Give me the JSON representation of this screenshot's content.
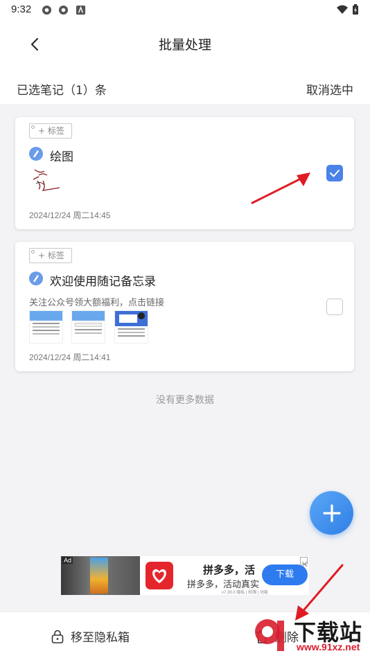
{
  "status_bar": {
    "time": "9:32"
  },
  "header": {
    "title": "批量处理",
    "selected_count": "已选笔记（1）条",
    "cancel_select": "取消选中"
  },
  "notes": [
    {
      "tag": "+ 标签",
      "title": "绘图",
      "subtitle": "",
      "date": "2024/12/24   周二14:45",
      "checked": true
    },
    {
      "tag": "+ 标签",
      "title": "欢迎使用随记备忘录",
      "subtitle": "关注公众号领大额福利，点击链接",
      "date": "2024/12/24   周二14:41",
      "checked": false
    }
  ],
  "no_more": "没有更多数据",
  "ad": {
    "tag": "Ad",
    "title": "拼多多，活",
    "desc": "拼多多，活动真实",
    "meta": "v7.39.0  隐私 | 权限 | 功能",
    "download": "下载"
  },
  "bottom_bar": {
    "move_private": "移至隐私箱",
    "delete": "删除"
  },
  "watermark": {
    "text": "下载站",
    "url": "www.91xz.net"
  },
  "colors": {
    "accent": "#4a82e8",
    "fab": "#2f7fe6",
    "arrow": "#e01b24"
  }
}
